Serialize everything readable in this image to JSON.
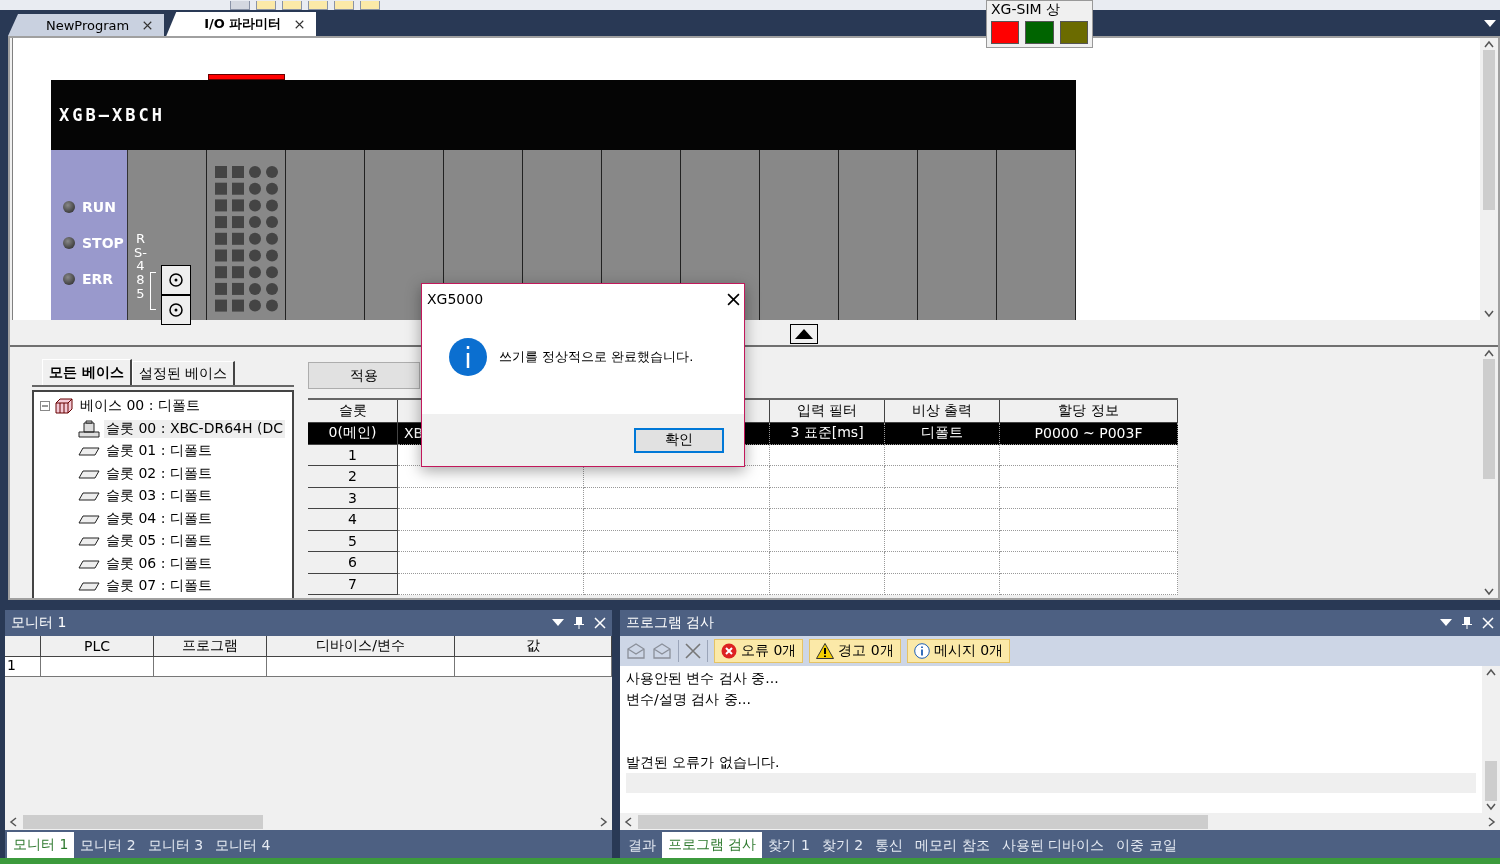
{
  "document_tabs": [
    {
      "label": "NewProgram",
      "selected": false
    },
    {
      "label": "I/O 파라미터",
      "selected": true
    }
  ],
  "simulator_popup": {
    "title": "XG-SIM 상",
    "lamps": [
      {
        "color": "#ff0000"
      },
      {
        "color": "#006400"
      },
      {
        "color": "#6b6b00"
      }
    ]
  },
  "rack": {
    "title": "XGB—XBCH",
    "leds": [
      {
        "label": "RUN"
      },
      {
        "label": "STOP"
      },
      {
        "label": "ERR"
      }
    ],
    "port_label": "RS-485"
  },
  "base_tabs": [
    {
      "label": "모든 베이스",
      "selected": true
    },
    {
      "label": "설정된 베이스",
      "selected": false
    }
  ],
  "tree": {
    "label": "베이스 00 : 디폴트",
    "expanded": true,
    "children": [
      {
        "label": "슬롯 00 : XBC-DR64H (DC",
        "kind": "cpu",
        "selected": true
      },
      {
        "label": "슬롯 01 : 디폴트",
        "kind": "slot",
        "selected": false
      },
      {
        "label": "슬롯 02 : 디폴트",
        "kind": "slot",
        "selected": false
      },
      {
        "label": "슬롯 03 : 디폴트",
        "kind": "slot",
        "selected": false
      },
      {
        "label": "슬롯 04 : 디폴트",
        "kind": "slot",
        "selected": false
      },
      {
        "label": "슬롯 05 : 디폴트",
        "kind": "slot",
        "selected": false
      },
      {
        "label": "슬롯 06 : 디폴트",
        "kind": "slot",
        "selected": false
      },
      {
        "label": "슬롯 07 : 디폴트",
        "kind": "slot",
        "selected": false
      }
    ]
  },
  "apply_button": "적용",
  "io_table": {
    "columns": {
      "slot": "슬롯",
      "input_filter": "입력 필터",
      "emergency_output": "비상 출력",
      "allocation": "할당 정보"
    },
    "rows": [
      {
        "slot": "0(메인)",
        "column_2": "XB",
        "input_filter": "3 표준[ms]",
        "emergency_output": "디폴트",
        "allocation": "P0000 ~ P003F",
        "selected": true
      },
      {
        "slot": "1",
        "selected": false
      },
      {
        "slot": "2",
        "selected": false
      },
      {
        "slot": "3",
        "selected": false
      },
      {
        "slot": "4",
        "selected": false
      },
      {
        "slot": "5",
        "selected": false
      },
      {
        "slot": "6",
        "selected": false
      },
      {
        "slot": "7",
        "selected": false
      }
    ]
  },
  "dialog": {
    "title": "XG5000",
    "message": "쓰기를 정상적으로 완료했습니다.",
    "button": "확인"
  },
  "monitor_panel": {
    "title": "모니터 1",
    "columns": [
      "PLC",
      "프로그램",
      "디바이스/변수",
      "값"
    ],
    "rows": [
      "1"
    ],
    "tabs": [
      {
        "label": "모니터 1",
        "selected": true
      },
      {
        "label": "모니터 2",
        "selected": false
      },
      {
        "label": "모니터 3",
        "selected": false
      },
      {
        "label": "모니터 4",
        "selected": false
      }
    ]
  },
  "check_panel": {
    "title": "프로그램 검사",
    "filters": [
      {
        "kind": "error",
        "label": "오류 0개"
      },
      {
        "kind": "warning",
        "label": "경고 0개"
      },
      {
        "kind": "info",
        "label": "메시지 0개"
      }
    ],
    "messages": [
      {
        "kind": "line",
        "text": "사용안된 변수 검사 중..."
      },
      {
        "kind": "line",
        "text": "변수/설명 검사 중..."
      },
      {
        "kind": "summary",
        "text": "발견된 오류가 없습니다."
      }
    ],
    "tabs": [
      {
        "label": "결과",
        "selected": false
      },
      {
        "label": "프로그램 검사",
        "selected": true
      },
      {
        "label": "찾기 1",
        "selected": false
      },
      {
        "label": "찾기 2",
        "selected": false
      },
      {
        "label": "통신",
        "selected": false
      },
      {
        "label": "메모리 참조",
        "selected": false
      },
      {
        "label": "사용된 디바이스",
        "selected": false
      },
      {
        "label": "이중 코일",
        "selected": false
      }
    ]
  }
}
